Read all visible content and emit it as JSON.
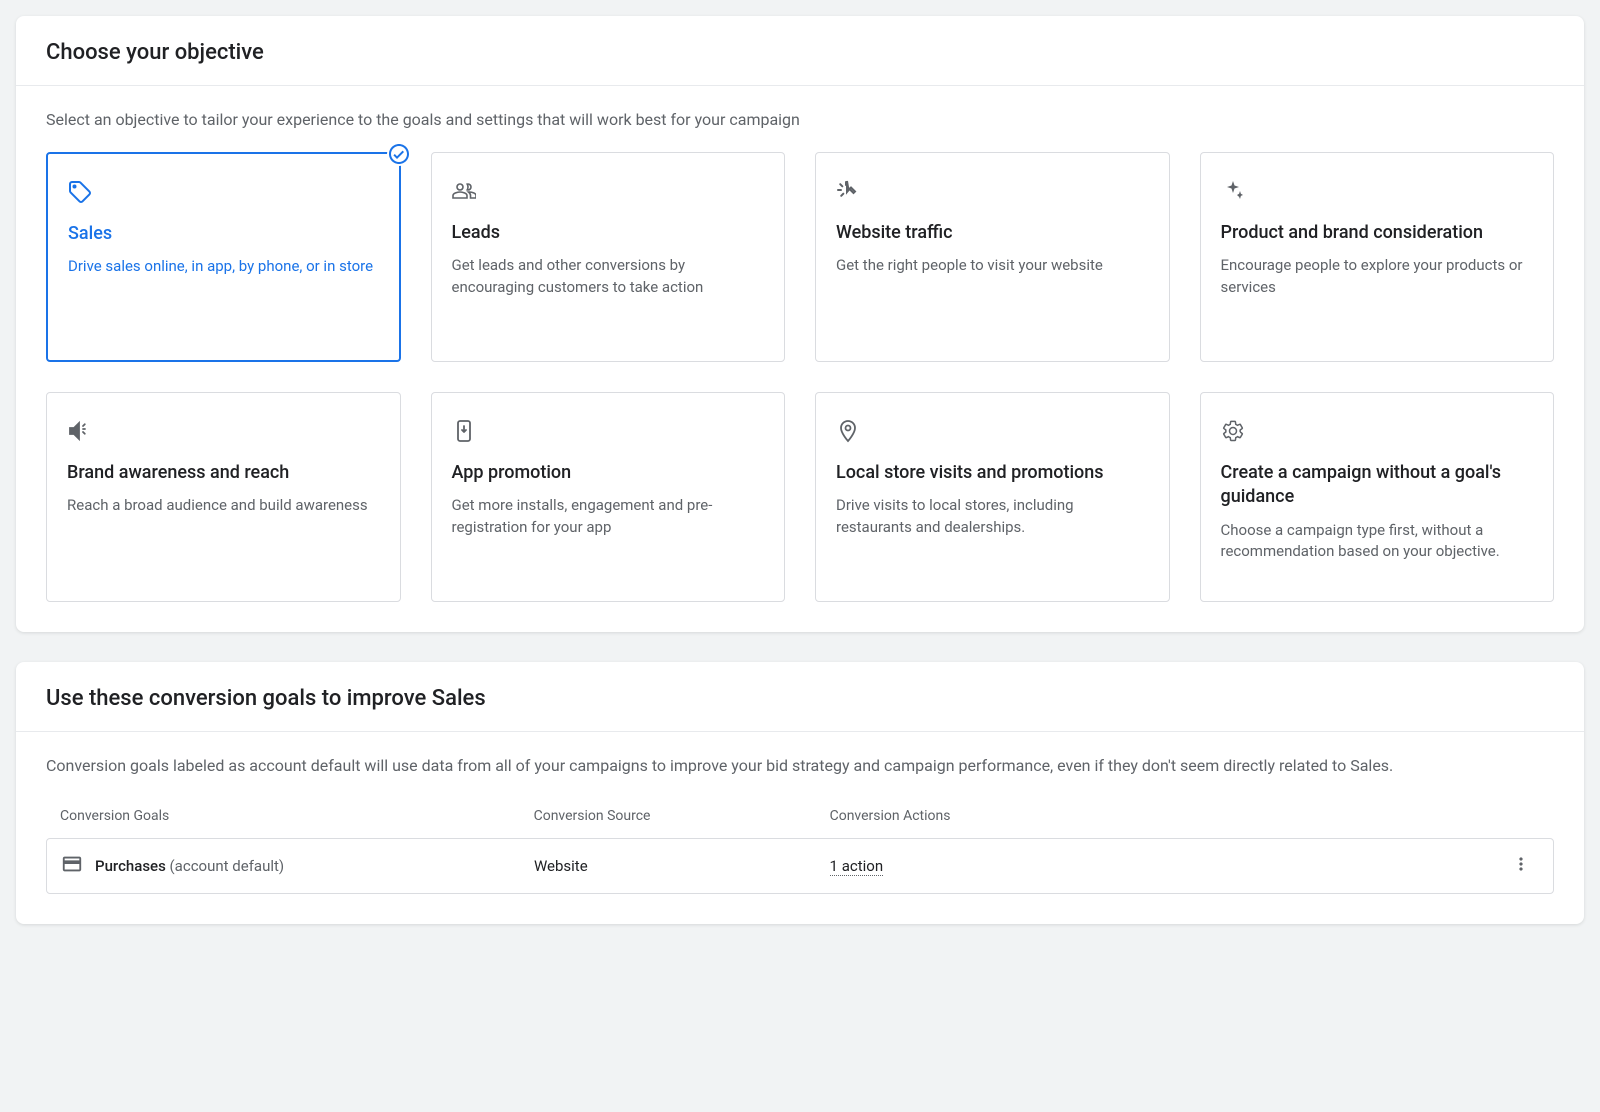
{
  "objective_section": {
    "title": "Choose your objective",
    "subtitle": "Select an objective to tailor your experience to the goals and settings that will work best for your campaign",
    "cards": [
      {
        "title": "Sales",
        "desc": "Drive sales online, in app, by phone, or in store",
        "selected": true
      },
      {
        "title": "Leads",
        "desc": "Get leads and other conversions by encouraging customers to take action",
        "selected": false
      },
      {
        "title": "Website traffic",
        "desc": "Get the right people to visit your website",
        "selected": false
      },
      {
        "title": "Product and brand consideration",
        "desc": "Encourage people to explore your products or services",
        "selected": false
      },
      {
        "title": "Brand awareness and reach",
        "desc": "Reach a broad audience and build awareness",
        "selected": false
      },
      {
        "title": "App promotion",
        "desc": "Get more installs, engagement and pre-registration for your app",
        "selected": false
      },
      {
        "title": "Local store visits and promotions",
        "desc": "Drive visits to local stores, including restaurants and dealerships.",
        "selected": false
      },
      {
        "title": "Create a campaign without a goal's guidance",
        "desc": "Choose a campaign type first, without a recommendation based on your objective.",
        "selected": false
      }
    ]
  },
  "goals_section": {
    "title": "Use these conversion goals to improve Sales",
    "subtitle": "Conversion goals labeled as account default will use data from all of your campaigns to improve your bid strategy and campaign performance, even if they don't seem directly related to Sales.",
    "columns": {
      "goals": "Conversion Goals",
      "source": "Conversion Source",
      "actions": "Conversion Actions"
    },
    "rows": [
      {
        "name": "Purchases",
        "suffix": "(account default)",
        "source": "Website",
        "actions": "1 action"
      }
    ]
  }
}
